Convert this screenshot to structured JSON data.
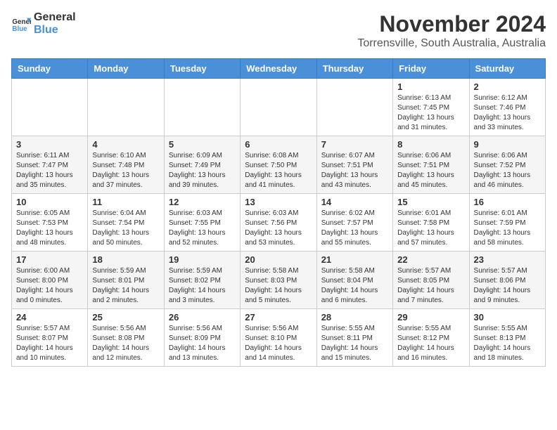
{
  "header": {
    "logo_general": "General",
    "logo_blue": "Blue",
    "month": "November 2024",
    "location": "Torrensville, South Australia, Australia"
  },
  "weekdays": [
    "Sunday",
    "Monday",
    "Tuesday",
    "Wednesday",
    "Thursday",
    "Friday",
    "Saturday"
  ],
  "weeks": [
    [
      {
        "day": "",
        "info": ""
      },
      {
        "day": "",
        "info": ""
      },
      {
        "day": "",
        "info": ""
      },
      {
        "day": "",
        "info": ""
      },
      {
        "day": "",
        "info": ""
      },
      {
        "day": "1",
        "info": "Sunrise: 6:13 AM\nSunset: 7:45 PM\nDaylight: 13 hours and 31 minutes."
      },
      {
        "day": "2",
        "info": "Sunrise: 6:12 AM\nSunset: 7:46 PM\nDaylight: 13 hours and 33 minutes."
      }
    ],
    [
      {
        "day": "3",
        "info": "Sunrise: 6:11 AM\nSunset: 7:47 PM\nDaylight: 13 hours and 35 minutes."
      },
      {
        "day": "4",
        "info": "Sunrise: 6:10 AM\nSunset: 7:48 PM\nDaylight: 13 hours and 37 minutes."
      },
      {
        "day": "5",
        "info": "Sunrise: 6:09 AM\nSunset: 7:49 PM\nDaylight: 13 hours and 39 minutes."
      },
      {
        "day": "6",
        "info": "Sunrise: 6:08 AM\nSunset: 7:50 PM\nDaylight: 13 hours and 41 minutes."
      },
      {
        "day": "7",
        "info": "Sunrise: 6:07 AM\nSunset: 7:51 PM\nDaylight: 13 hours and 43 minutes."
      },
      {
        "day": "8",
        "info": "Sunrise: 6:06 AM\nSunset: 7:51 PM\nDaylight: 13 hours and 45 minutes."
      },
      {
        "day": "9",
        "info": "Sunrise: 6:06 AM\nSunset: 7:52 PM\nDaylight: 13 hours and 46 minutes."
      }
    ],
    [
      {
        "day": "10",
        "info": "Sunrise: 6:05 AM\nSunset: 7:53 PM\nDaylight: 13 hours and 48 minutes."
      },
      {
        "day": "11",
        "info": "Sunrise: 6:04 AM\nSunset: 7:54 PM\nDaylight: 13 hours and 50 minutes."
      },
      {
        "day": "12",
        "info": "Sunrise: 6:03 AM\nSunset: 7:55 PM\nDaylight: 13 hours and 52 minutes."
      },
      {
        "day": "13",
        "info": "Sunrise: 6:03 AM\nSunset: 7:56 PM\nDaylight: 13 hours and 53 minutes."
      },
      {
        "day": "14",
        "info": "Sunrise: 6:02 AM\nSunset: 7:57 PM\nDaylight: 13 hours and 55 minutes."
      },
      {
        "day": "15",
        "info": "Sunrise: 6:01 AM\nSunset: 7:58 PM\nDaylight: 13 hours and 57 minutes."
      },
      {
        "day": "16",
        "info": "Sunrise: 6:01 AM\nSunset: 7:59 PM\nDaylight: 13 hours and 58 minutes."
      }
    ],
    [
      {
        "day": "17",
        "info": "Sunrise: 6:00 AM\nSunset: 8:00 PM\nDaylight: 14 hours and 0 minutes."
      },
      {
        "day": "18",
        "info": "Sunrise: 5:59 AM\nSunset: 8:01 PM\nDaylight: 14 hours and 2 minutes."
      },
      {
        "day": "19",
        "info": "Sunrise: 5:59 AM\nSunset: 8:02 PM\nDaylight: 14 hours and 3 minutes."
      },
      {
        "day": "20",
        "info": "Sunrise: 5:58 AM\nSunset: 8:03 PM\nDaylight: 14 hours and 5 minutes."
      },
      {
        "day": "21",
        "info": "Sunrise: 5:58 AM\nSunset: 8:04 PM\nDaylight: 14 hours and 6 minutes."
      },
      {
        "day": "22",
        "info": "Sunrise: 5:57 AM\nSunset: 8:05 PM\nDaylight: 14 hours and 7 minutes."
      },
      {
        "day": "23",
        "info": "Sunrise: 5:57 AM\nSunset: 8:06 PM\nDaylight: 14 hours and 9 minutes."
      }
    ],
    [
      {
        "day": "24",
        "info": "Sunrise: 5:57 AM\nSunset: 8:07 PM\nDaylight: 14 hours and 10 minutes."
      },
      {
        "day": "25",
        "info": "Sunrise: 5:56 AM\nSunset: 8:08 PM\nDaylight: 14 hours and 12 minutes."
      },
      {
        "day": "26",
        "info": "Sunrise: 5:56 AM\nSunset: 8:09 PM\nDaylight: 14 hours and 13 minutes."
      },
      {
        "day": "27",
        "info": "Sunrise: 5:56 AM\nSunset: 8:10 PM\nDaylight: 14 hours and 14 minutes."
      },
      {
        "day": "28",
        "info": "Sunrise: 5:55 AM\nSunset: 8:11 PM\nDaylight: 14 hours and 15 minutes."
      },
      {
        "day": "29",
        "info": "Sunrise: 5:55 AM\nSunset: 8:12 PM\nDaylight: 14 hours and 16 minutes."
      },
      {
        "day": "30",
        "info": "Sunrise: 5:55 AM\nSunset: 8:13 PM\nDaylight: 14 hours and 18 minutes."
      }
    ]
  ]
}
